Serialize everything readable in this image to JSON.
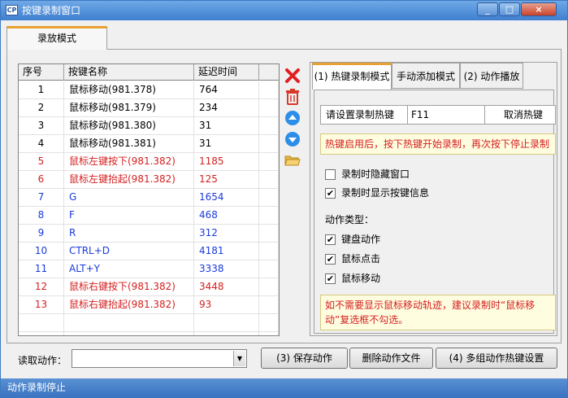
{
  "window": {
    "title": "按键录制窗口",
    "icon_text": "CP",
    "icon_name": "app-icon",
    "controls": [
      "_",
      "□",
      "×"
    ]
  },
  "main_tab": {
    "label": "录放模式"
  },
  "table": {
    "columns": [
      "序号",
      "按键名称",
      "延迟时间"
    ],
    "rows": [
      {
        "index": "1",
        "name": "鼠标移动(981.378)",
        "delay": "764",
        "color": "black"
      },
      {
        "index": "2",
        "name": "鼠标移动(981.379)",
        "delay": "234",
        "color": "black"
      },
      {
        "index": "3",
        "name": "鼠标移动(981.380)",
        "delay": "31",
        "color": "black"
      },
      {
        "index": "4",
        "name": "鼠标移动(981.381)",
        "delay": "31",
        "color": "black"
      },
      {
        "index": "5",
        "name": "鼠标左键按下(981.382)",
        "delay": "1185",
        "color": "red"
      },
      {
        "index": "6",
        "name": "鼠标左键抬起(981.382)",
        "delay": "125",
        "color": "red"
      },
      {
        "index": "7",
        "name": "G",
        "delay": "1654",
        "color": "blue"
      },
      {
        "index": "8",
        "name": "F",
        "delay": "468",
        "color": "blue"
      },
      {
        "index": "9",
        "name": "R",
        "delay": "312",
        "color": "blue"
      },
      {
        "index": "10",
        "name": "CTRL+D",
        "delay": "4181",
        "color": "blue"
      },
      {
        "index": "11",
        "name": "ALT+Y",
        "delay": "3338",
        "color": "blue"
      },
      {
        "index": "12",
        "name": "鼠标右键按下(981.382)",
        "delay": "3448",
        "color": "red"
      },
      {
        "index": "13",
        "name": "鼠标右键抬起(981.382)",
        "delay": "93",
        "color": "red"
      }
    ],
    "empty_rows": 2,
    "colors": {
      "black": "#000000",
      "red": "#d42020",
      "blue": "#1a3adb"
    }
  },
  "side_icons": [
    "delete-icon",
    "trash-icon",
    "move-up-icon",
    "move-down-icon",
    "open-folder-icon"
  ],
  "right_tabs": [
    {
      "label": "(1) 热键录制模式",
      "active": true
    },
    {
      "label": "手动添加模式",
      "active": false
    },
    {
      "label": "(2) 动作播放",
      "active": false
    }
  ],
  "hotkey": {
    "label": "请设置录制热键",
    "value": "F11",
    "cancel": "取消热键"
  },
  "hint_top": "热键启用后，按下热键开始录制，再次按下停止录制",
  "options": [
    {
      "label": "录制时隐藏窗口",
      "checked": false
    },
    {
      "label": "录制时显示按键信息",
      "checked": true
    }
  ],
  "action_type": {
    "label": "动作类型：",
    "items": [
      {
        "label": "键盘动作",
        "checked": true
      },
      {
        "label": "鼠标点击",
        "checked": true
      },
      {
        "label": "鼠标移动",
        "checked": true
      }
    ]
  },
  "hint_bottom": "如不需要显示鼠标移动轨迹，建议录制时“鼠标移动”复选框不勾选。",
  "bottom": {
    "read_label": "读取动作：",
    "read_value": "",
    "save_button": "(3) 保存动作",
    "delete_button": "删除动作文件",
    "hotkey_button": "(4) 多组动作热键设置"
  },
  "status": "动作录制停止"
}
